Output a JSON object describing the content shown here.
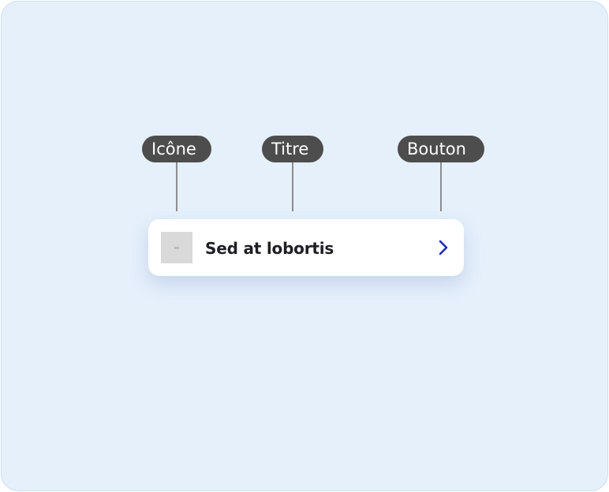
{
  "labels": {
    "icon": "Icône",
    "title": "Titre",
    "button": "Bouton"
  },
  "item": {
    "title": "Sed at lobortis"
  },
  "icons": {
    "thumbnail": "image-placeholder-icon",
    "action": "chevron-right-icon"
  },
  "colors": {
    "background": "#e5f0fb",
    "tag": "#4d4d4d",
    "accent": "#1f2bb8"
  }
}
